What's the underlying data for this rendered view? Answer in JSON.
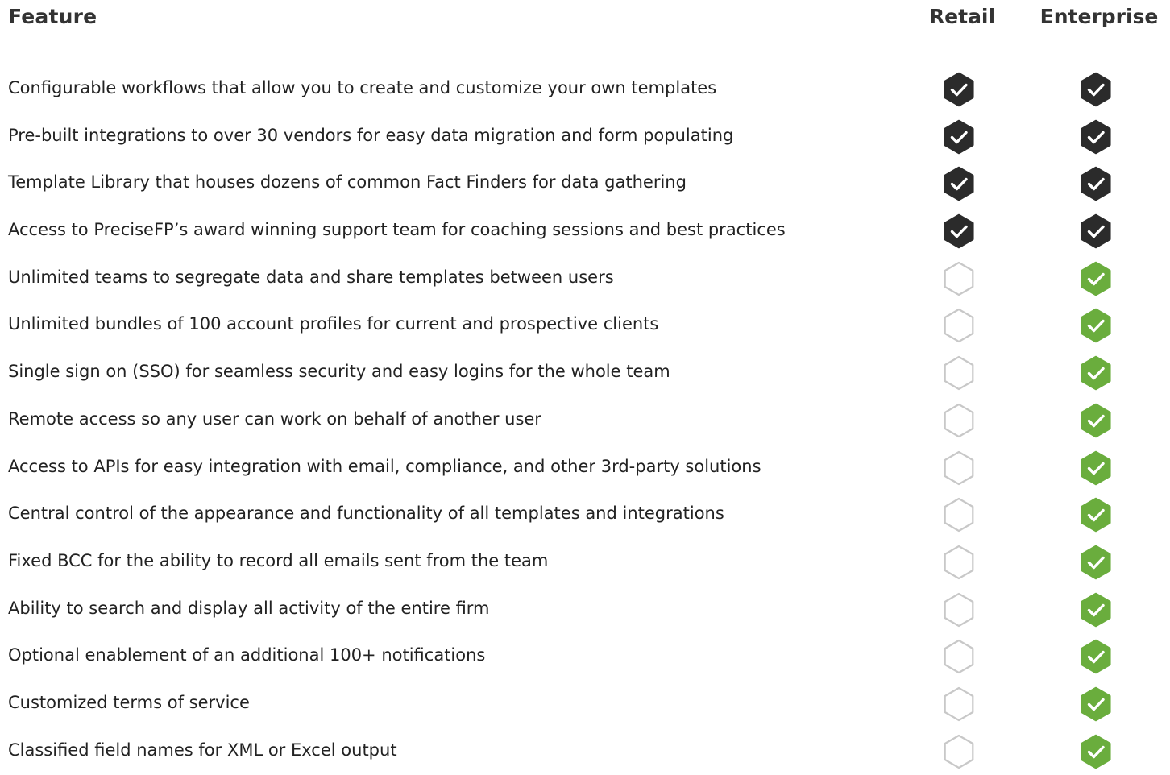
{
  "header": {
    "feature": "Feature",
    "retail": "Retail",
    "enterprise": "Enterprise"
  },
  "colors": {
    "check_dark": "#2b2b2b",
    "check_green": "#6aad3d",
    "empty_outline": "#c8c8c8"
  },
  "rows": [
    {
      "label": "Configurable workflows that allow you to create and customize your own templates",
      "retail": "check-dark",
      "enterprise": "check-dark"
    },
    {
      "label": "Pre-built integrations to over 30 vendors for easy data migration and form populating",
      "retail": "check-dark",
      "enterprise": "check-dark"
    },
    {
      "label": "Template Library that houses dozens of common Fact Finders for data gathering",
      "retail": "check-dark",
      "enterprise": "check-dark"
    },
    {
      "label": "Access to PreciseFP’s award winning support team for coaching sessions and best practices",
      "retail": "check-dark",
      "enterprise": "check-dark"
    },
    {
      "label": "Unlimited teams to segregate data and share templates between users",
      "retail": "empty",
      "enterprise": "check-green"
    },
    {
      "label": "Unlimited bundles of 100 account profiles for current and prospective clients",
      "retail": "empty",
      "enterprise": "check-green"
    },
    {
      "label": "Single sign on (SSO) for seamless security and easy logins for the whole team",
      "retail": "empty",
      "enterprise": "check-green"
    },
    {
      "label": "Remote access so any user can work on behalf of another user",
      "retail": "empty",
      "enterprise": "check-green"
    },
    {
      "label": "Access to APIs for easy integration with email, compliance, and other 3rd-party solutions",
      "retail": "empty",
      "enterprise": "check-green"
    },
    {
      "label": "Central control of the appearance and functionality of all templates and integrations",
      "retail": "empty",
      "enterprise": "check-green"
    },
    {
      "label": "Fixed BCC for the ability to record all emails sent from the team",
      "retail": "empty",
      "enterprise": "check-green"
    },
    {
      "label": "Ability to search and display all activity of the entire firm",
      "retail": "empty",
      "enterprise": "check-green"
    },
    {
      "label": "Optional enablement of an additional 100+ notifications",
      "retail": "empty",
      "enterprise": "check-green"
    },
    {
      "label": "Customized terms of service",
      "retail": "empty",
      "enterprise": "check-green"
    },
    {
      "label": "Classified field names for XML or Excel output",
      "retail": "empty",
      "enterprise": "check-green"
    }
  ]
}
